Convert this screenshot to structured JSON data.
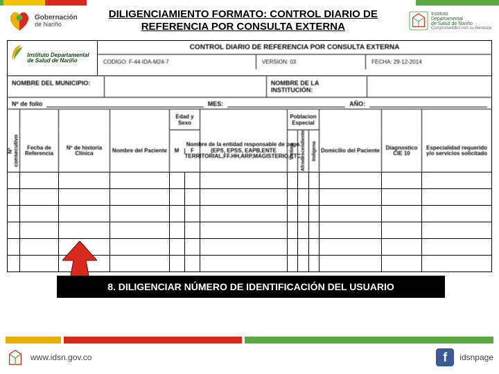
{
  "header": {
    "gob_line1": "Gobernación",
    "gob_line2": "de Nariño",
    "title": "DILIGENCIAMIENTO FORMATO: CONTROL DIARIO DE REFERENCIA POR CONSULTA EXTERNA",
    "inst_line1": "Instituto",
    "inst_line2": "Departamental",
    "inst_line3": "de Salud de Nariño",
    "inst_tag": "Comprometidos con su bienestar"
  },
  "form": {
    "logo_text": "Instituto Departamental de Salud de Nariño",
    "title": "CONTROL DIARIO DE REFERENCIA POR CONSULTA EXTERNA",
    "codigo": "CODIGO: F-44-IDA-M24-7",
    "version": "VERSION: 03",
    "fecha": "FECHA: 29-12-2014",
    "mun_label": "NOMBRE DEL MUNICIPIO:",
    "inst_label": "NOMBRE DE LA INSTITUCIÓN:",
    "folio_label": "Nº de folio",
    "mes_label": "MES:",
    "ano_label": "AÑO:",
    "head": {
      "consec": "Nº consecutivo",
      "fecha_ref": "Fecha de Referencia",
      "historia": "Nº de historia Clínica",
      "paciente": "Nombre del Paciente",
      "edad_sexo": "Edad y Sexo",
      "m": "M",
      "f": "F",
      "entidad": "Nombre de la entidad responsable de pago. (EPS, EPSS, EAPB,ENTE TERRITORIAL,FF.HH,ARP,MAGISTERIO,ETC.",
      "pob": "Poblacion Especial",
      "victima": "Victima",
      "afro": "Afrodescendiente",
      "indigena": "Indigena",
      "domicilio": "Domicilio del Paciente",
      "cie": "Diagnostico CIE 10",
      "espec": "Especialidad requerido y/o servicios solicitado"
    }
  },
  "callout": "8. DILIGENCIAR NÚMERO DE IDENTIFICACIÓN DEL USUARIO",
  "footer": {
    "url": "www.idsn.gov.co",
    "fb": "idsnpage"
  }
}
